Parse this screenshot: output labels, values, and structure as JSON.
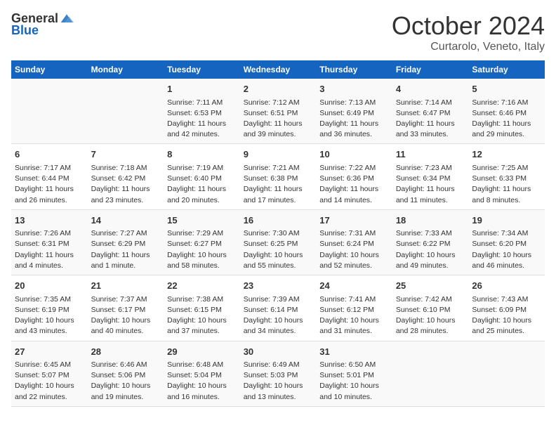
{
  "header": {
    "logo_general": "General",
    "logo_blue": "Blue",
    "month": "October 2024",
    "location": "Curtarolo, Veneto, Italy"
  },
  "weekdays": [
    "Sunday",
    "Monday",
    "Tuesday",
    "Wednesday",
    "Thursday",
    "Friday",
    "Saturday"
  ],
  "weeks": [
    [
      {
        "day": "",
        "content": ""
      },
      {
        "day": "",
        "content": ""
      },
      {
        "day": "1",
        "content": "Sunrise: 7:11 AM\nSunset: 6:53 PM\nDaylight: 11 hours and 42 minutes."
      },
      {
        "day": "2",
        "content": "Sunrise: 7:12 AM\nSunset: 6:51 PM\nDaylight: 11 hours and 39 minutes."
      },
      {
        "day": "3",
        "content": "Sunrise: 7:13 AM\nSunset: 6:49 PM\nDaylight: 11 hours and 36 minutes."
      },
      {
        "day": "4",
        "content": "Sunrise: 7:14 AM\nSunset: 6:47 PM\nDaylight: 11 hours and 33 minutes."
      },
      {
        "day": "5",
        "content": "Sunrise: 7:16 AM\nSunset: 6:46 PM\nDaylight: 11 hours and 29 minutes."
      }
    ],
    [
      {
        "day": "6",
        "content": "Sunrise: 7:17 AM\nSunset: 6:44 PM\nDaylight: 11 hours and 26 minutes."
      },
      {
        "day": "7",
        "content": "Sunrise: 7:18 AM\nSunset: 6:42 PM\nDaylight: 11 hours and 23 minutes."
      },
      {
        "day": "8",
        "content": "Sunrise: 7:19 AM\nSunset: 6:40 PM\nDaylight: 11 hours and 20 minutes."
      },
      {
        "day": "9",
        "content": "Sunrise: 7:21 AM\nSunset: 6:38 PM\nDaylight: 11 hours and 17 minutes."
      },
      {
        "day": "10",
        "content": "Sunrise: 7:22 AM\nSunset: 6:36 PM\nDaylight: 11 hours and 14 minutes."
      },
      {
        "day": "11",
        "content": "Sunrise: 7:23 AM\nSunset: 6:34 PM\nDaylight: 11 hours and 11 minutes."
      },
      {
        "day": "12",
        "content": "Sunrise: 7:25 AM\nSunset: 6:33 PM\nDaylight: 11 hours and 8 minutes."
      }
    ],
    [
      {
        "day": "13",
        "content": "Sunrise: 7:26 AM\nSunset: 6:31 PM\nDaylight: 11 hours and 4 minutes."
      },
      {
        "day": "14",
        "content": "Sunrise: 7:27 AM\nSunset: 6:29 PM\nDaylight: 11 hours and 1 minute."
      },
      {
        "day": "15",
        "content": "Sunrise: 7:29 AM\nSunset: 6:27 PM\nDaylight: 10 hours and 58 minutes."
      },
      {
        "day": "16",
        "content": "Sunrise: 7:30 AM\nSunset: 6:25 PM\nDaylight: 10 hours and 55 minutes."
      },
      {
        "day": "17",
        "content": "Sunrise: 7:31 AM\nSunset: 6:24 PM\nDaylight: 10 hours and 52 minutes."
      },
      {
        "day": "18",
        "content": "Sunrise: 7:33 AM\nSunset: 6:22 PM\nDaylight: 10 hours and 49 minutes."
      },
      {
        "day": "19",
        "content": "Sunrise: 7:34 AM\nSunset: 6:20 PM\nDaylight: 10 hours and 46 minutes."
      }
    ],
    [
      {
        "day": "20",
        "content": "Sunrise: 7:35 AM\nSunset: 6:19 PM\nDaylight: 10 hours and 43 minutes."
      },
      {
        "day": "21",
        "content": "Sunrise: 7:37 AM\nSunset: 6:17 PM\nDaylight: 10 hours and 40 minutes."
      },
      {
        "day": "22",
        "content": "Sunrise: 7:38 AM\nSunset: 6:15 PM\nDaylight: 10 hours and 37 minutes."
      },
      {
        "day": "23",
        "content": "Sunrise: 7:39 AM\nSunset: 6:14 PM\nDaylight: 10 hours and 34 minutes."
      },
      {
        "day": "24",
        "content": "Sunrise: 7:41 AM\nSunset: 6:12 PM\nDaylight: 10 hours and 31 minutes."
      },
      {
        "day": "25",
        "content": "Sunrise: 7:42 AM\nSunset: 6:10 PM\nDaylight: 10 hours and 28 minutes."
      },
      {
        "day": "26",
        "content": "Sunrise: 7:43 AM\nSunset: 6:09 PM\nDaylight: 10 hours and 25 minutes."
      }
    ],
    [
      {
        "day": "27",
        "content": "Sunrise: 6:45 AM\nSunset: 5:07 PM\nDaylight: 10 hours and 22 minutes."
      },
      {
        "day": "28",
        "content": "Sunrise: 6:46 AM\nSunset: 5:06 PM\nDaylight: 10 hours and 19 minutes."
      },
      {
        "day": "29",
        "content": "Sunrise: 6:48 AM\nSunset: 5:04 PM\nDaylight: 10 hours and 16 minutes."
      },
      {
        "day": "30",
        "content": "Sunrise: 6:49 AM\nSunset: 5:03 PM\nDaylight: 10 hours and 13 minutes."
      },
      {
        "day": "31",
        "content": "Sunrise: 6:50 AM\nSunset: 5:01 PM\nDaylight: 10 hours and 10 minutes."
      },
      {
        "day": "",
        "content": ""
      },
      {
        "day": "",
        "content": ""
      }
    ]
  ]
}
